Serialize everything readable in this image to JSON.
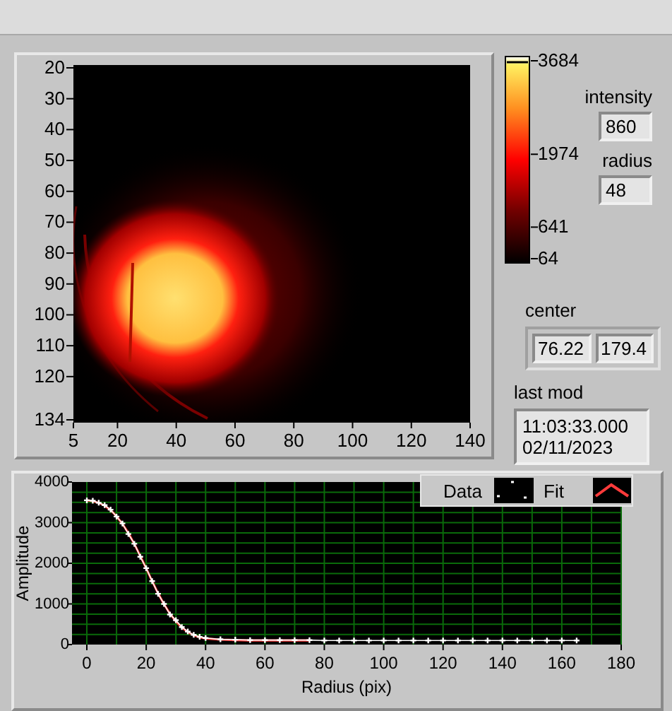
{
  "image_panel": {
    "y_ticks": [
      "20",
      "30",
      "40",
      "50",
      "60",
      "70",
      "80",
      "90",
      "100",
      "110",
      "120",
      "134"
    ],
    "x_ticks": [
      "5",
      "20",
      "40",
      "60",
      "80",
      "100",
      "120",
      "140"
    ]
  },
  "color_scale": {
    "ticks": [
      "3684",
      "1974",
      "641",
      "64"
    ]
  },
  "intensity": {
    "label": "intensity",
    "value": "860"
  },
  "radius": {
    "label": "radius",
    "value": "48"
  },
  "center": {
    "label": "center",
    "values": [
      "76.22",
      "179.4"
    ]
  },
  "last_mod": {
    "label": "last mod",
    "value": "11:03:33.000\n02/11/2023"
  },
  "profile_graph": {
    "chart_data": {
      "type": "line",
      "xlabel": "Radius (pix)",
      "ylabel": "Amplitude",
      "xlim": [
        -5,
        180
      ],
      "ylim": [
        0,
        4000
      ],
      "xticks": [
        0,
        20,
        40,
        60,
        80,
        100,
        120,
        140,
        160,
        180
      ],
      "yticks": [
        0,
        1000,
        2000,
        3000,
        4000
      ],
      "grid": true,
      "legend": true,
      "x": [
        0,
        2,
        4,
        6,
        8,
        10,
        12,
        14,
        16,
        18,
        20,
        22,
        24,
        26,
        28,
        30,
        32,
        34,
        36,
        38,
        40,
        45,
        50,
        55,
        60,
        65,
        70,
        75,
        80,
        85,
        90,
        95,
        100,
        105,
        110,
        115,
        120,
        125,
        130,
        135,
        140,
        145,
        150,
        155,
        160,
        165
      ],
      "series": [
        {
          "name": "Data",
          "color": "#ffffff",
          "marker": "plus",
          "values": [
            3550,
            3540,
            3490,
            3430,
            3320,
            3150,
            2980,
            2720,
            2480,
            2160,
            1880,
            1560,
            1250,
            1000,
            740,
            600,
            430,
            320,
            240,
            190,
            160,
            130,
            120,
            110,
            110,
            110,
            110,
            110,
            100,
            100,
            100,
            100,
            100,
            100,
            100,
            100,
            100,
            100,
            100,
            100,
            100,
            100,
            100,
            100,
            100,
            100
          ]
        },
        {
          "name": "Fit",
          "color": "#ff3b3b",
          "values": [
            3550,
            3530,
            3490,
            3420,
            3310,
            3160,
            2970,
            2740,
            2470,
            2180,
            1870,
            1560,
            1260,
            990,
            760,
            570,
            420,
            310,
            230,
            180,
            150,
            120,
            110,
            100,
            100,
            100,
            100,
            100,
            null,
            null,
            null,
            null,
            null,
            null,
            null,
            null,
            null,
            null,
            null,
            null,
            null,
            null,
            null,
            null,
            null,
            null
          ]
        }
      ]
    }
  }
}
